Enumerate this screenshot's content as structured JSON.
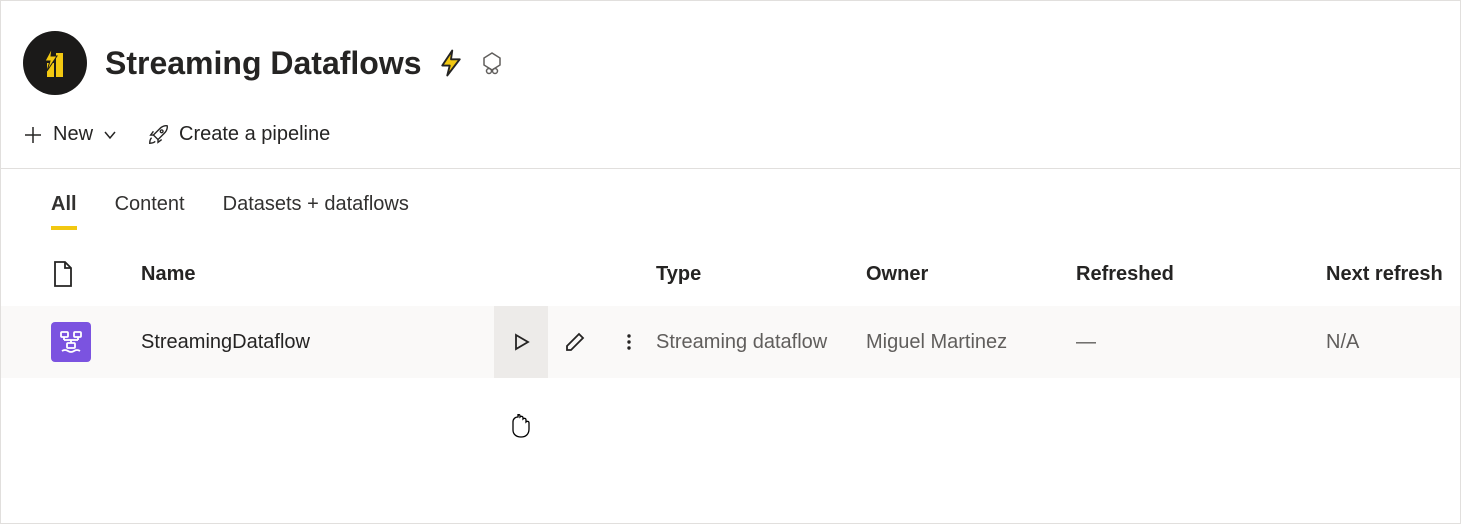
{
  "workspace": {
    "title": "Streaming Dataflows"
  },
  "toolbar": {
    "new_label": "New",
    "pipeline_label": "Create a pipeline"
  },
  "tabs": [
    {
      "label": "All",
      "active": true
    },
    {
      "label": "Content",
      "active": false
    },
    {
      "label": "Datasets + dataflows",
      "active": false
    }
  ],
  "table": {
    "columns": {
      "name": "Name",
      "type": "Type",
      "owner": "Owner",
      "refreshed": "Refreshed",
      "next_refresh": "Next refresh"
    },
    "rows": [
      {
        "name": "StreamingDataflow",
        "type": "Streaming dataflow",
        "owner": "Miguel Martinez",
        "refreshed": "—",
        "next_refresh": "N/A"
      }
    ]
  }
}
